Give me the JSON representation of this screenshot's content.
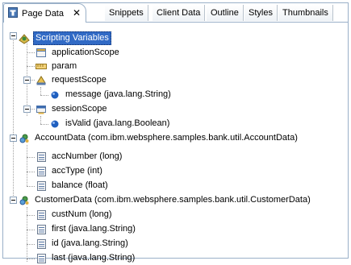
{
  "tabs": [
    {
      "label": "Page Data",
      "close": "✕",
      "active": true
    },
    {
      "label": "Snippets"
    },
    {
      "label": "Client Data"
    },
    {
      "label": "Outline"
    },
    {
      "label": "Styles"
    },
    {
      "label": "Thumbnails"
    }
  ],
  "tree": {
    "scripting": {
      "label": "Scripting Variables",
      "icon": "scripting-variables-icon",
      "children": {
        "application": {
          "label": "applicationScope",
          "icon": "application-scope-icon"
        },
        "param": {
          "label": "param",
          "icon": "param-icon"
        },
        "request": {
          "label": "requestScope",
          "icon": "request-scope-icon",
          "children": {
            "message": {
              "label": "message (java.lang.String)",
              "icon": "bean-property-dot-icon"
            }
          }
        },
        "session": {
          "label": "sessionScope",
          "icon": "session-scope-icon",
          "children": {
            "isValid": {
              "label": "isValid (java.lang.Boolean)",
              "icon": "bean-property-dot-icon"
            }
          }
        }
      }
    },
    "account": {
      "label": "AccountData (com.ibm.websphere.samples.bank.util.AccountData)",
      "icon": "java-bean-icon",
      "children": [
        {
          "label": "accNumber (long)"
        },
        {
          "label": "accType (int)"
        },
        {
          "label": "balance (float)"
        }
      ]
    },
    "customer": {
      "label": "CustomerData (com.ibm.websphere.samples.bank.util.CustomerData)",
      "icon": "java-bean-icon",
      "children": [
        {
          "label": "custNum (long)"
        },
        {
          "label": "first (java.lang.String)"
        },
        {
          "label": "id (java.lang.String)"
        },
        {
          "label": "last (java.lang.String)"
        }
      ]
    }
  },
  "colors": {
    "selection": "#316ac5",
    "border": "#9ab0c8",
    "dot": "#1f5fbf"
  }
}
